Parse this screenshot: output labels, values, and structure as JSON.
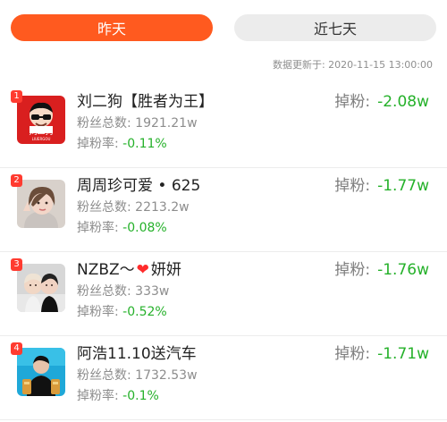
{
  "tabs": {
    "yesterday": "昨天",
    "last_seven_days": "近七天"
  },
  "update_time": "数据更新于: 2020-11-15 13:00:00",
  "labels": {
    "fans_total": "粉丝总数:",
    "drop_rate": "掉粉率:",
    "drop": "掉粉:"
  },
  "items": [
    {
      "rank": "1",
      "name": "刘二狗【胜者为王】",
      "fans_total": "1921.21w",
      "drop_rate": "-0.11%",
      "drop": "-2.08w",
      "avatar_text": "刘二狗",
      "avatar_subtext": "LIUERGOU"
    },
    {
      "rank": "2",
      "name": "周周珍可爱 • 625",
      "fans_total": "2213.2w",
      "drop_rate": "-0.08%",
      "drop": "-1.77w"
    },
    {
      "rank": "3",
      "name_prefix": "NZBZ～",
      "name_suffix": "妍妍",
      "fans_total": "333w",
      "drop_rate": "-0.52%",
      "drop": "-1.76w"
    },
    {
      "rank": "4",
      "name": "阿浩11.10送汽车",
      "fans_total": "1732.53w",
      "drop_rate": "-0.1%",
      "drop": "-1.71w"
    }
  ],
  "colors": {
    "active_tab": "#ff5a1f",
    "inactive_tab": "#ececec",
    "rank_badge": "#ff3b30",
    "drop_green": "#25b12a",
    "muted_text": "#8d8d8d"
  },
  "icons": {
    "avatar_1": "cartoon-sunglasses-avatar",
    "avatar_2": "woman-selfie-avatar",
    "avatar_3": "two-people-avatar",
    "avatar_4": "man-with-products-avatar",
    "heart": "heart-icon"
  }
}
